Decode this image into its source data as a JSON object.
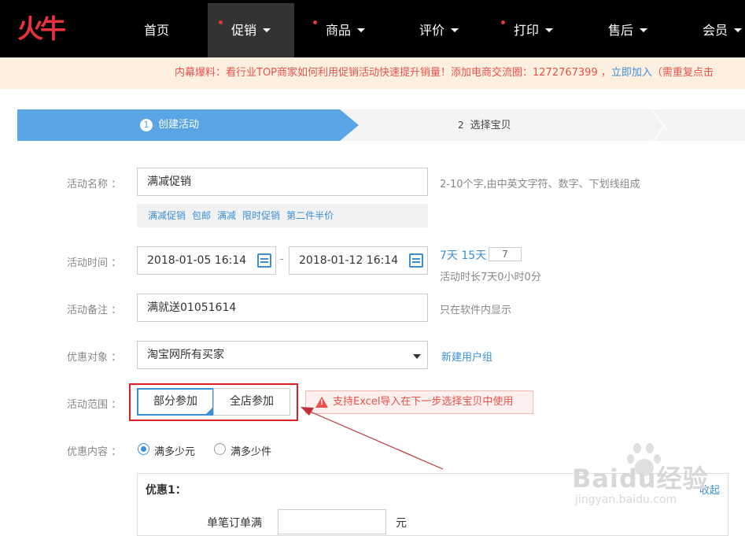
{
  "logo": {
    "text": "火牛",
    "color": "#e8323c"
  },
  "nav": {
    "items": [
      {
        "label": "首页",
        "dot": false,
        "dropdown": false,
        "active": false
      },
      {
        "label": "促销",
        "dot": true,
        "dropdown": true,
        "active": true
      },
      {
        "label": "商品",
        "dot": true,
        "dropdown": true,
        "active": false
      },
      {
        "label": "评价",
        "dot": false,
        "dropdown": true,
        "active": false
      },
      {
        "label": "打印",
        "dot": true,
        "dropdown": true,
        "active": false
      },
      {
        "label": "售后",
        "dot": false,
        "dropdown": true,
        "active": false
      },
      {
        "label": "会员",
        "dot": false,
        "dropdown": true,
        "active": false
      }
    ]
  },
  "notice": {
    "text": "内幕爆料：看行业TOP商家如何利用促销活动快速提升销量！添加电商交流圈：1272767399 ，",
    "link": "立即加入",
    "tail": "（需重复点击"
  },
  "steps": {
    "step1": {
      "num": "1",
      "label": "创建活动"
    },
    "step2": {
      "num": "2",
      "label": "选择宝贝"
    }
  },
  "form": {
    "name": {
      "label": "活动名称 ：",
      "value": "满减促销",
      "hint": "2-10个字,由中英文字符、数字、下划线组成",
      "tags": [
        "满减促销",
        "包邮",
        "满减",
        "限时促销",
        "第二件半价"
      ]
    },
    "time": {
      "label": "活动时间 ：",
      "start": "2018-01-05 16:14",
      "sep": "-",
      "end": "2018-01-12 16:14",
      "quick1": "7天",
      "quick2": "15天",
      "days": "7",
      "duration": "活动时长7天0小时0分"
    },
    "note": {
      "label": "活动备注 ：",
      "value": "满就送01051614",
      "hint": "只在软件内显示"
    },
    "target": {
      "label": "优惠对象 ：",
      "value": "淘宝网所有买家",
      "link": "新建用户组"
    },
    "scope": {
      "label": "活动范围 ：",
      "option1": "部分参加",
      "option2": "全店参加",
      "warning": "支持Excel导入在下一步选择宝贝中使用"
    },
    "content": {
      "label": "优惠内容 ：",
      "radio1": "满多少元",
      "radio2": "满多少件"
    }
  },
  "promo": {
    "title": "优惠1：",
    "collapse": "收起",
    "row_label": "单笔订单满",
    "unit": "元"
  },
  "watermark": {
    "main": "Baidu经验",
    "sub": "jingyan.baidu.com"
  },
  "colors": {
    "accent": "#3a8fd6",
    "step": "#5aa5e6",
    "annotation": "#e02020",
    "warn": "#e8524a"
  }
}
